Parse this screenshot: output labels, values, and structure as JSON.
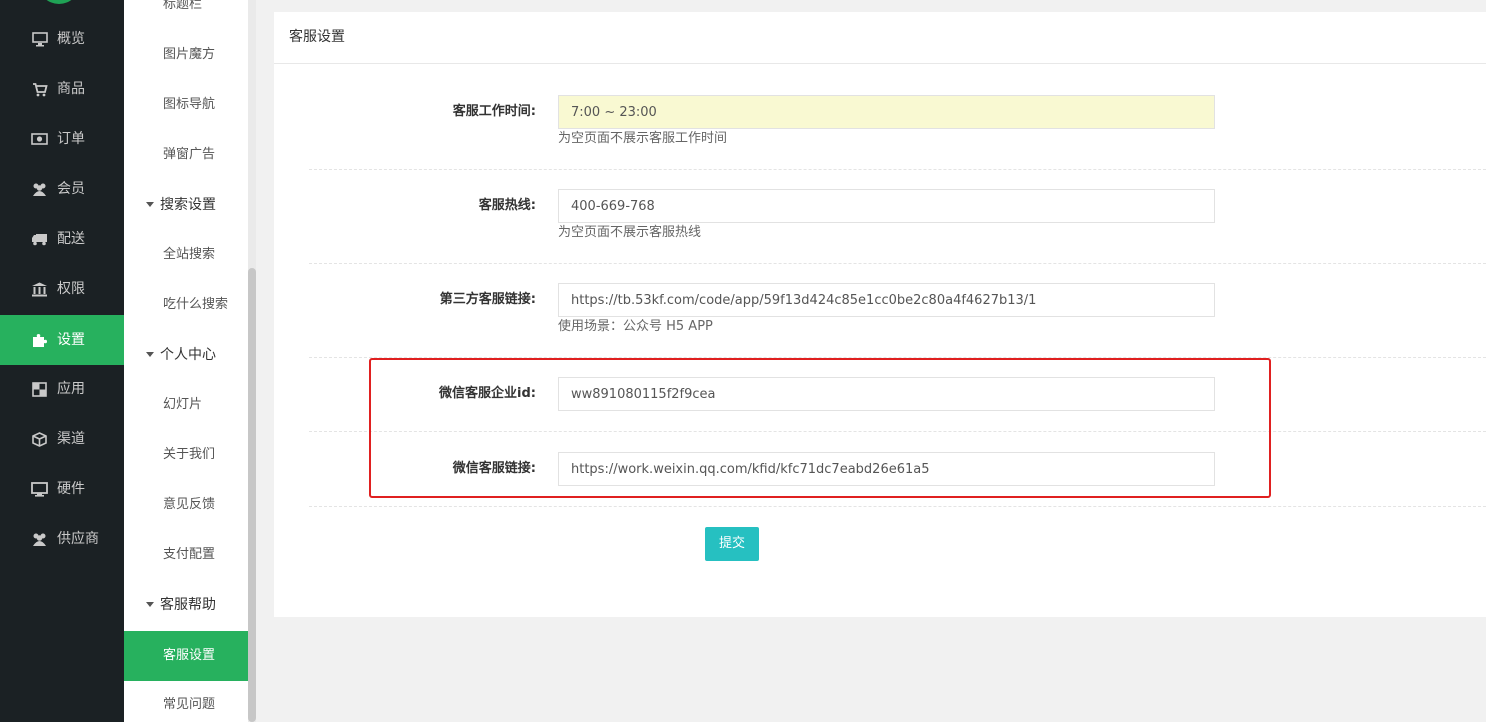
{
  "sidebar": {
    "items": [
      {
        "label": "概览",
        "icon": "monitor-icon"
      },
      {
        "label": "商品",
        "icon": "cart-icon"
      },
      {
        "label": "订单",
        "icon": "money-icon"
      },
      {
        "label": "会员",
        "icon": "users-icon"
      },
      {
        "label": "配送",
        "icon": "truck-icon"
      },
      {
        "label": "权限",
        "icon": "bank-icon"
      },
      {
        "label": "设置",
        "icon": "puzzle-icon",
        "active": true
      },
      {
        "label": "应用",
        "icon": "apps-icon"
      },
      {
        "label": "渠道",
        "icon": "cube-icon"
      },
      {
        "label": "硬件",
        "icon": "desktop-icon"
      },
      {
        "label": "供应商",
        "icon": "users-icon"
      }
    ]
  },
  "subnav": {
    "top_item": "标题栏",
    "items_a": [
      "图片魔方",
      "图标导航",
      "弹窗广告"
    ],
    "group_search": "搜索设置",
    "items_b": [
      "全站搜索",
      "吃什么搜索"
    ],
    "group_personal": "个人中心",
    "items_c": [
      "幻灯片",
      "关于我们",
      "意见反馈",
      "支付配置"
    ],
    "group_help": "客服帮助",
    "items_d": [
      "客服设置",
      "常见问题"
    ]
  },
  "panel": {
    "title": "客服设置"
  },
  "form": {
    "work_time": {
      "label": "客服工作时间:",
      "value": "7:00 ~ 23:00",
      "hint": "为空页面不展示客服工作时间"
    },
    "hotline": {
      "label": "客服热线:",
      "value": "400-669-768",
      "hint": "为空页面不展示客服热线"
    },
    "third_party": {
      "label": "第三方客服链接:",
      "value": "https://tb.53kf.com/code/app/59f13d424c85e1cc0be2c80a4f4627b13/1",
      "hint": "使用场景：公众号 H5 APP"
    },
    "wx_corp_id": {
      "label": "微信客服企业id:",
      "value": "ww891080115f2f9cea"
    },
    "wx_link": {
      "label": "微信客服链接:",
      "value": "https://work.weixin.qq.com/kfid/kfc71dc7eabd26e61a5"
    },
    "submit_label": "提交"
  },
  "colors": {
    "sidebar_bg": "#1b2124",
    "accent_green": "#27b15e",
    "submit_button": "#26c0c1",
    "highlight_box": "#e02020",
    "input_highlight": "#f9f9d2"
  }
}
